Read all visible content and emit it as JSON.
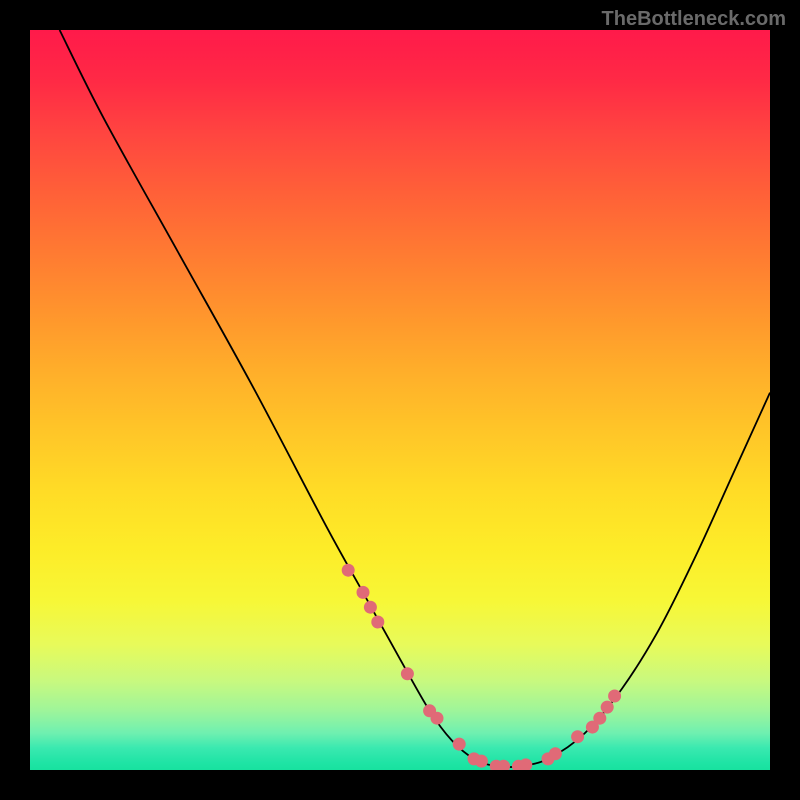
{
  "watermark": "TheBottleneck.com",
  "chart_data": {
    "type": "line",
    "title": "",
    "xlabel": "",
    "ylabel": "",
    "xlim": [
      0,
      100
    ],
    "ylim": [
      0,
      100
    ],
    "series": [
      {
        "name": "curve",
        "x": [
          4,
          10,
          20,
          30,
          40,
          45,
          50,
          54,
          57,
          60,
          63,
          66,
          70,
          75,
          80,
          85,
          90,
          95,
          100
        ],
        "y": [
          100,
          88,
          70,
          52,
          33,
          24,
          15,
          8,
          4,
          1.5,
          0.5,
          0.5,
          1.5,
          5,
          11,
          19,
          29,
          40,
          51
        ]
      }
    ],
    "markers": {
      "x": [
        43,
        45,
        46,
        47,
        51,
        54,
        55,
        58,
        60,
        61,
        63,
        64,
        66,
        67,
        70,
        71,
        74,
        76,
        77,
        78,
        79
      ],
      "y": [
        27,
        24,
        22,
        20,
        13,
        8,
        7,
        3.5,
        1.5,
        1.2,
        0.5,
        0.5,
        0.5,
        0.7,
        1.5,
        2.2,
        4.5,
        5.8,
        7,
        8.5,
        10
      ]
    },
    "colors": {
      "curve": "#000000",
      "marker": "#e06a77"
    }
  }
}
